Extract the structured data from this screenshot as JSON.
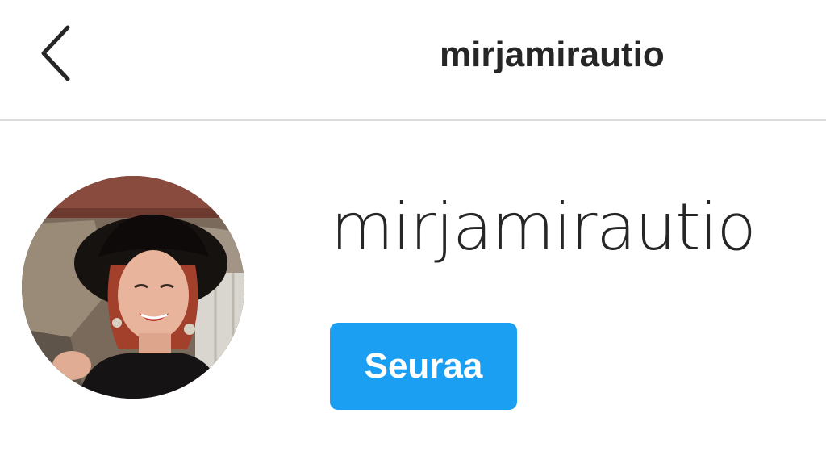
{
  "header": {
    "back_icon": "chevron-left-icon",
    "title": "mirjamirautio"
  },
  "profile": {
    "username": "mirjamirautio",
    "follow_label": "Seuraa",
    "follow_color": "#1a9ff3"
  }
}
